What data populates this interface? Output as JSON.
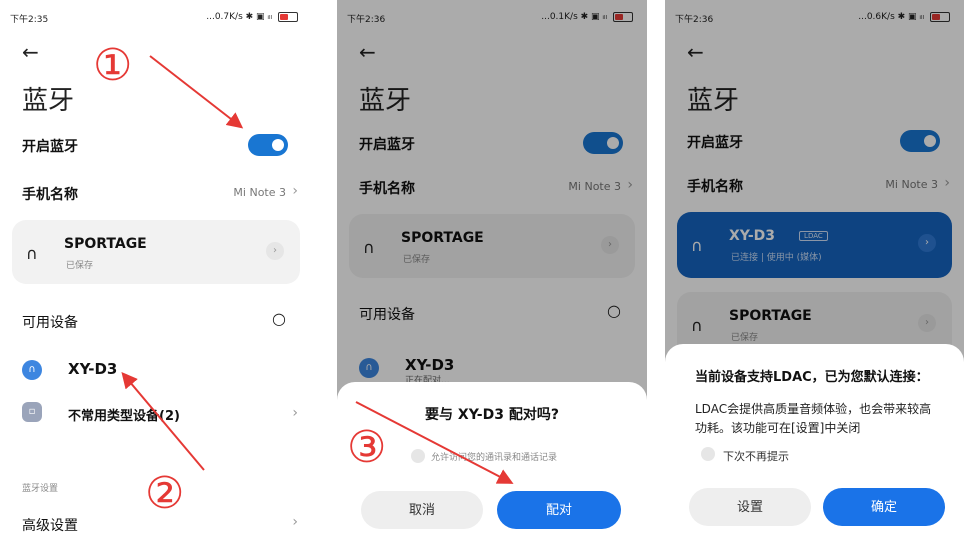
{
  "colors": {
    "accent": "#1a73e8",
    "annotation": "#e53935",
    "selected_card": "#1565c0"
  },
  "screens": [
    {
      "status": {
        "time": "下午2:35",
        "network": "...0.7K/s ✱ ▣ ᵢₗₗ"
      },
      "title": "蓝牙",
      "bt_toggle_label": "开启蓝牙",
      "phone_name_label": "手机名称",
      "phone_name_value": "Mi Note 3",
      "paired": [
        {
          "name": "SPORTAGE",
          "status": "已保存"
        }
      ],
      "available_header": "可用设备",
      "available": [
        {
          "name": "XY-D3"
        },
        {
          "name": "不常用类型设备(2)"
        }
      ],
      "settings_section": "蓝牙设置",
      "advanced_label": "高级设置",
      "annotations": [
        "①",
        "②"
      ]
    },
    {
      "status": {
        "time": "下午2:36",
        "network": "...0.1K/s ✱ ▣ ᵢₗₗ"
      },
      "title": "蓝牙",
      "bt_toggle_label": "开启蓝牙",
      "phone_name_label": "手机名称",
      "phone_name_value": "Mi Note 3",
      "paired": [
        {
          "name": "SPORTAGE",
          "status": "已保存"
        }
      ],
      "available_header": "可用设备",
      "available": [
        {
          "name": "XY-D3",
          "status": "正在配对..."
        }
      ],
      "dialog": {
        "question": "要与 XY-D3 配对吗?",
        "checkbox_label": "允许访问您的通讯录和通话记录",
        "cancel": "取消",
        "confirm": "配对"
      },
      "annotations": [
        "③"
      ]
    },
    {
      "status": {
        "time": "下午2:36",
        "network": "...0.6K/s ✱ ▣ ᵢₗₗ"
      },
      "title": "蓝牙",
      "bt_toggle_label": "开启蓝牙",
      "phone_name_label": "手机名称",
      "phone_name_value": "Mi Note 3",
      "connected": {
        "name": "XY-D3",
        "badge": "LDAC",
        "status": "已连接 | 使用中 (媒体)"
      },
      "paired": [
        {
          "name": "SPORTAGE",
          "status": "已保存"
        }
      ],
      "dialog": {
        "title": "当前设备支持LDAC，已为您默认连接：",
        "body": "LDAC会提供高质量音频体验，也会带来较高功耗。该功能可在[设置]中关闭",
        "checkbox_label": "下次不再提示",
        "settings": "设置",
        "confirm": "确定"
      }
    }
  ]
}
